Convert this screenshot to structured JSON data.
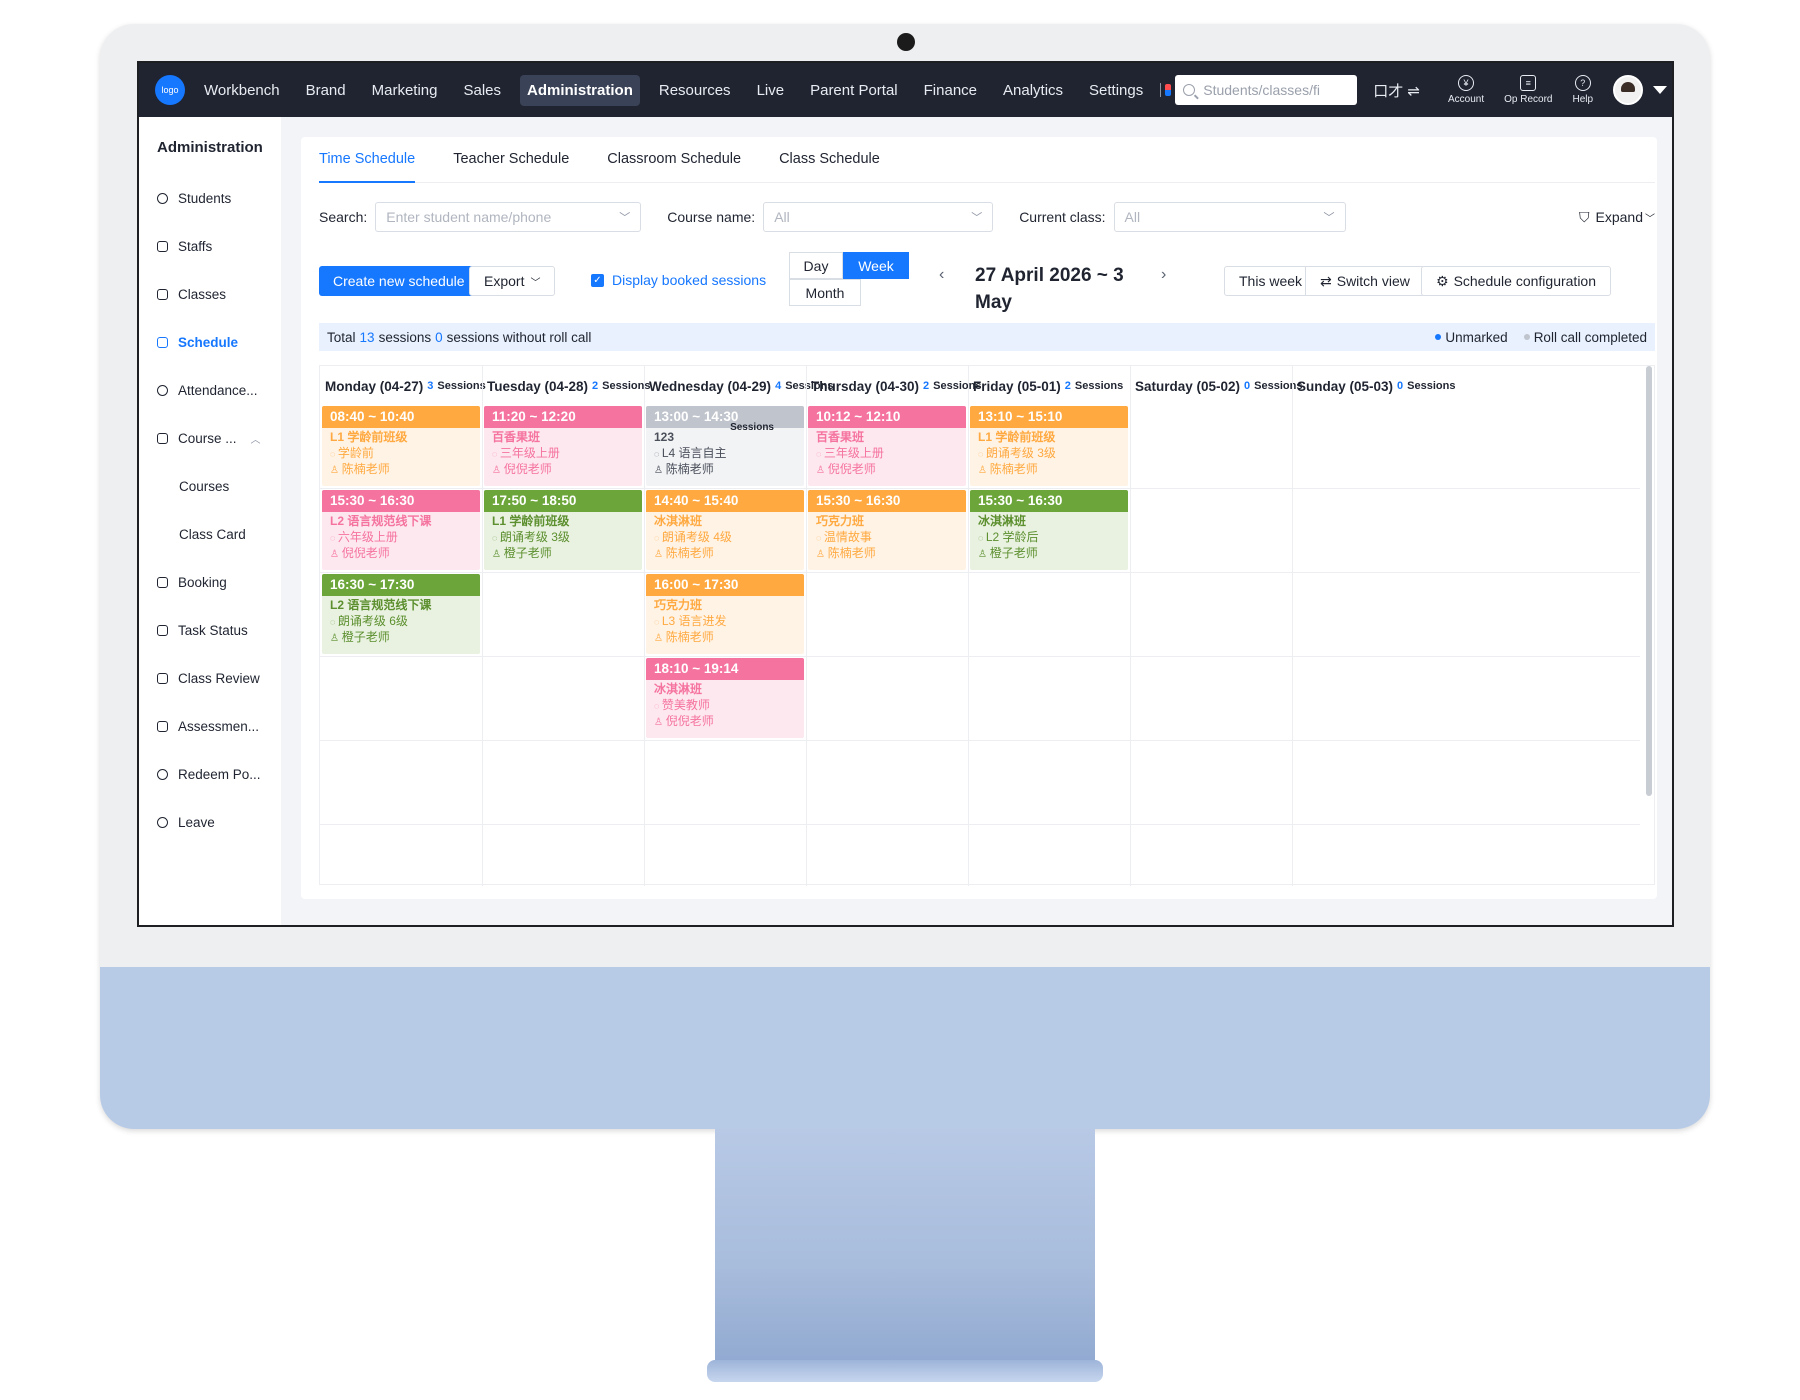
{
  "nav": {
    "logo": "logo",
    "items": [
      "Workbench",
      "Brand",
      "Marketing",
      "Sales",
      "Administration",
      "Resources",
      "Live",
      "Parent Portal",
      "Finance",
      "Analytics",
      "Settings"
    ],
    "active_index": 4,
    "search_placeholder": "Students/classes/fi",
    "swap_label": "口才 ⇌",
    "account": "Account",
    "op_record": "Op Record",
    "help": "Help"
  },
  "sidebar": {
    "title": "Administration",
    "items": [
      {
        "label": "Students",
        "active": false
      },
      {
        "label": "Staffs",
        "active": false
      },
      {
        "label": "Classes",
        "active": false
      },
      {
        "label": "Schedule",
        "active": true
      },
      {
        "label": "Attendance...",
        "active": false
      },
      {
        "label": "Course ...",
        "active": false
      },
      {
        "label": "Courses",
        "active": false
      },
      {
        "label": "Class Card",
        "active": false
      },
      {
        "label": "Booking",
        "active": false
      },
      {
        "label": "Task Status",
        "active": false
      },
      {
        "label": "Class Review",
        "active": false
      },
      {
        "label": "Assessmen...",
        "active": false
      },
      {
        "label": "Redeem Po...",
        "active": false
      },
      {
        "label": "Leave",
        "active": false
      }
    ]
  },
  "tabs": [
    "Time Schedule",
    "Teacher Schedule",
    "Classroom Schedule",
    "Class Schedule"
  ],
  "filters": {
    "search_label": "Search:",
    "search_placeholder": "Enter student name/phone",
    "course_label": "Course name:",
    "course_value": "All",
    "class_label": "Current class:",
    "class_value": "All",
    "expand": "Expand"
  },
  "toolbar": {
    "create": "Create new schedule",
    "export": "Export",
    "display_booked": "Display booked sessions",
    "view_day": "Day",
    "view_week": "Week",
    "view_month": "Month",
    "date_range": "27 April 2026 ~ 3 May",
    "this_week": "This week",
    "switch_view": "Switch view",
    "schedule_config": "Schedule configuration"
  },
  "summary": {
    "total_prefix": "Total",
    "total_sessions": "13",
    "sessions_word": "sessions",
    "without_count": "0",
    "without_text": "sessions without roll call",
    "unmarked": "Unmarked",
    "roll_call_completed": "Roll call completed",
    "unmarked_color": "#1677ff",
    "completed_color": "#c0c4cc"
  },
  "days": [
    {
      "name": "Monday (04-27)",
      "count": "3",
      "sess": "Sessions"
    },
    {
      "name": "Tuesday (04-28)",
      "count": "2",
      "sess": "Sessions"
    },
    {
      "name": "Wednesday (04-29)",
      "count": "4",
      "sess": "Sessions"
    },
    {
      "name": "Thursday (04-30)",
      "count": "2",
      "sess": "Sessions"
    },
    {
      "name": "Friday (05-01)",
      "count": "2",
      "sess": "Sessions"
    },
    {
      "name": "Saturday (05-02)",
      "count": "0",
      "sess": "Sessions"
    },
    {
      "name": "Sunday (05-03)",
      "count": "0",
      "sess": "Sessions"
    }
  ],
  "events": [
    {
      "day": 0,
      "row": 0,
      "color": "orange",
      "time": "08:40 ~ 10:40",
      "title": "L1 学龄前班级",
      "course": "学龄前",
      "teacher": "陈楠老师"
    },
    {
      "day": 0,
      "row": 1,
      "color": "pink",
      "time": "15:30 ~ 16:30",
      "title": "L2 语言规范线下课",
      "course": "六年级上册",
      "teacher": "倪倪老师"
    },
    {
      "day": 0,
      "row": 2,
      "color": "green",
      "time": "16:30 ~ 17:30",
      "title": "L2 语言规范线下课",
      "course": "朗诵考级 6级",
      "teacher": "橙子老师"
    },
    {
      "day": 1,
      "row": 0,
      "color": "pink",
      "time": "11:20 ~ 12:20",
      "title": "百香果班",
      "course": "三年级上册",
      "teacher": "倪倪老师"
    },
    {
      "day": 1,
      "row": 1,
      "color": "green",
      "time": "17:50 ~ 18:50",
      "title": "L1 学龄前班级",
      "course": "朗诵考级 3级",
      "teacher": "橙子老师"
    },
    {
      "day": 2,
      "row": 0,
      "color": "gray",
      "time": "13:00 ~ 14:30",
      "title": "123",
      "course": "L4 语言自主",
      "teacher": "陈楠老师",
      "note": "Sessions"
    },
    {
      "day": 2,
      "row": 1,
      "color": "orange",
      "time": "14:40 ~ 15:40",
      "title": "冰淇淋班",
      "course": "朗诵考级 4级",
      "teacher": "陈楠老师"
    },
    {
      "day": 2,
      "row": 2,
      "color": "orange",
      "time": "16:00 ~ 17:30",
      "title": "巧克力班",
      "course": "L3 语言进发",
      "teacher": "陈楠老师"
    },
    {
      "day": 2,
      "row": 3,
      "color": "pink",
      "time": "18:10 ~ 19:14",
      "title": "冰淇淋班",
      "course": "赞美教师",
      "teacher": "倪倪老师"
    },
    {
      "day": 3,
      "row": 0,
      "color": "pink",
      "time": "10:12 ~ 12:10",
      "title": "百香果班",
      "course": "三年级上册",
      "teacher": "倪倪老师"
    },
    {
      "day": 3,
      "row": 1,
      "color": "orange",
      "time": "15:30 ~ 16:30",
      "title": "巧克力班",
      "course": "温情故事",
      "teacher": "陈楠老师"
    },
    {
      "day": 4,
      "row": 0,
      "color": "orange",
      "time": "13:10 ~ 15:10",
      "title": "L1 学龄前班级",
      "course": "朗诵考级 3级",
      "teacher": "陈楠老师"
    },
    {
      "day": 4,
      "row": 1,
      "color": "green",
      "time": "15:30 ~ 16:30",
      "title": "冰淇淋班",
      "course": "L2 学龄后",
      "teacher": "橙子老师"
    }
  ]
}
